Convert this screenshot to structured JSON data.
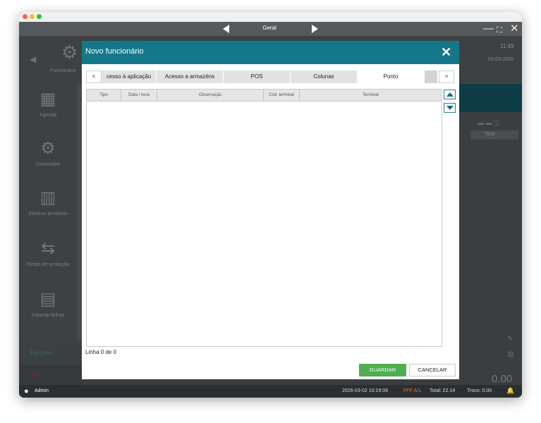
{
  "topbar": {
    "title": "Geral"
  },
  "background": {
    "module_label": "Funcionário",
    "clock": "11:49",
    "date": "02-03-2026",
    "select_value": "Total",
    "sidebar": [
      {
        "label": "Agenda",
        "icon": "calendar-icon"
      },
      {
        "label": "Comissões",
        "icon": "gears-icon"
      },
      {
        "label": "Eliminar produtos",
        "icon": "delete-products-icon"
      },
      {
        "label": "Fichas de produção",
        "icon": "production-sheet-icon"
      },
      {
        "label": "Importar linhas",
        "icon": "import-lines-icon"
      }
    ],
    "functions_label": "Funções",
    "exit_label": "Sair",
    "amount": "0.00"
  },
  "modal": {
    "title": "Novo funcionário",
    "tabs": [
      {
        "label": "cesso à aplicação",
        "active": false
      },
      {
        "label": "Acesso a armazéns",
        "active": false
      },
      {
        "label": "POS",
        "active": false
      },
      {
        "label": "Colunas",
        "active": false
      },
      {
        "label": "Ponto",
        "active": true
      }
    ],
    "tab_prev": "<",
    "tab_next": ">",
    "grid": {
      "columns": [
        "Tipo",
        "Data / hora",
        "Observação",
        "Cód. terminal",
        "Terminal"
      ],
      "rows": []
    },
    "row_count": "Linha 0 de 0",
    "save_label": "GUARDAR",
    "cancel_label": "CANCELAR"
  },
  "statusbar": {
    "user": "Admin",
    "datetime": "2026-03-02 10:19:09",
    "document": "FFF A/1",
    "total": "Total:  22.14",
    "change": "Troco:  0.00"
  },
  "colors": {
    "header_teal": "#14788a",
    "save_green": "#4caf50",
    "document_orange": "#d67b2c"
  }
}
